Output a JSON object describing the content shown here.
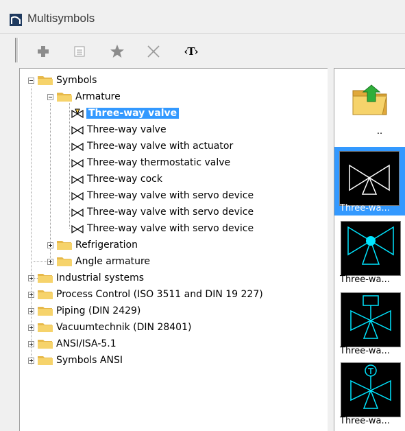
{
  "window": {
    "title": "Multisymbols"
  },
  "toolbar": {
    "buttons": [
      {
        "name": "add-icon"
      },
      {
        "name": "properties-icon"
      },
      {
        "name": "favorite-star-icon"
      },
      {
        "name": "delete-x-icon"
      },
      {
        "name": "text-tool",
        "label": "‹T›"
      }
    ]
  },
  "tree": {
    "symbols": "Symbols",
    "armature": "Armature",
    "armature_items": [
      "Three-way valve",
      "Three-way valve",
      "Three-way valve with actuator",
      "Three-way thermostatic valve",
      "Three-way cock",
      "Three-way valve with servo device",
      "Three-way valve with servo device",
      "Three-way valve with servo device"
    ],
    "refrigeration": "Refrigeration",
    "angle_armature": "Angle armature",
    "roots": [
      "Industrial systems",
      "Process Control (ISO 3511 and DIN 19 227)",
      "Piping (DIN 2429)",
      "Vacuumtechnik (DIN 28401)",
      "ANSI/ISA-5.1",
      "Symbols ANSI"
    ]
  },
  "preview": {
    "parent_label": "..",
    "items": [
      {
        "caption": "Three-wa..."
      },
      {
        "caption": "Three-wa..."
      },
      {
        "caption": "Three-wa..."
      },
      {
        "caption": "Three-wa..."
      }
    ]
  },
  "colors": {
    "selection": "#3399ff",
    "symbol_cyan": "#00e5ff",
    "folder": "#f2c94c"
  }
}
